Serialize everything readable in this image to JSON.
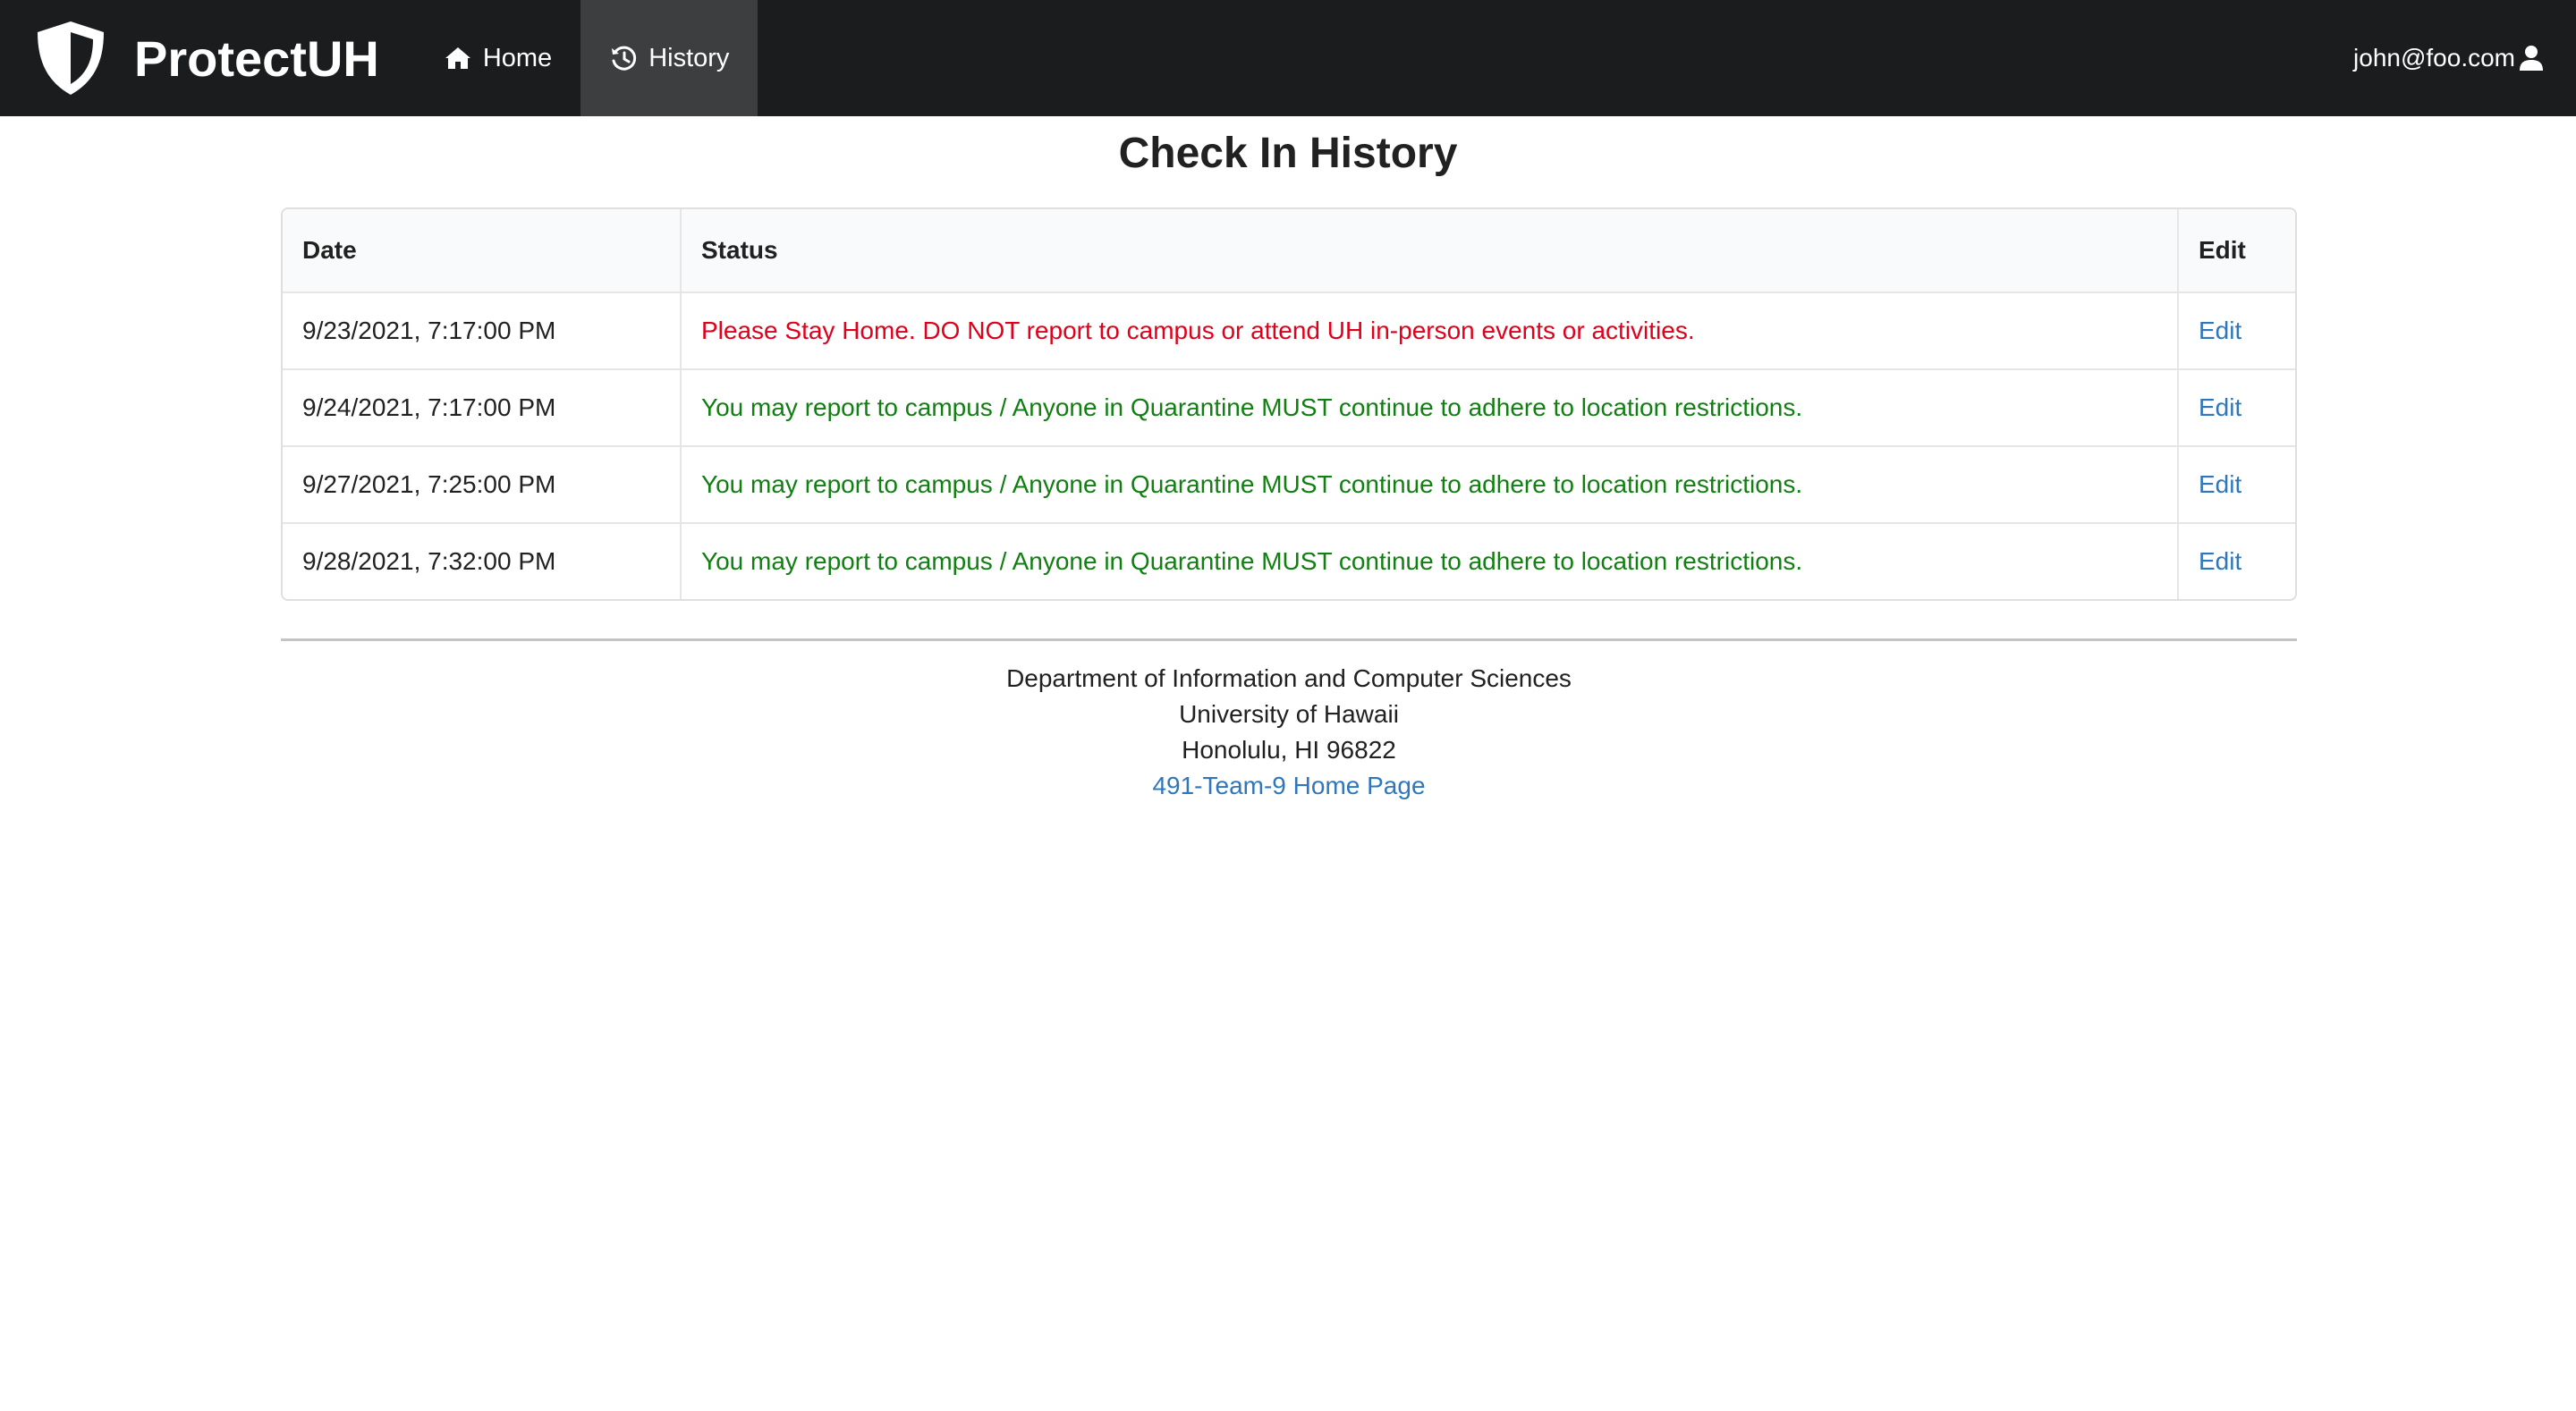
{
  "nav": {
    "brand": "ProtectUH",
    "items": [
      {
        "label": "Home",
        "icon": "home-icon"
      },
      {
        "label": "History",
        "icon": "history-icon",
        "active": true
      }
    ],
    "user_email": "john@foo.com",
    "user_icon": "user-icon"
  },
  "page": {
    "title": "Check In History"
  },
  "table": {
    "headers": {
      "date": "Date",
      "status": "Status",
      "edit": "Edit"
    },
    "rows": [
      {
        "date": "9/23/2021, 7:17:00 PM",
        "status": "Please Stay Home. DO NOT report to campus or attend UH in-person events or activities.",
        "status_type": "stay-home",
        "edit": "Edit"
      },
      {
        "date": "9/24/2021, 7:17:00 PM",
        "status": "You may report to campus / Anyone in Quarantine MUST continue to adhere to location restrictions.",
        "status_type": "clear",
        "edit": "Edit"
      },
      {
        "date": "9/27/2021, 7:25:00 PM",
        "status": "You may report to campus / Anyone in Quarantine MUST continue to adhere to location restrictions.",
        "status_type": "clear",
        "edit": "Edit"
      },
      {
        "date": "9/28/2021, 7:32:00 PM",
        "status": "You may report to campus / Anyone in Quarantine MUST continue to adhere to location restrictions.",
        "status_type": "clear",
        "edit": "Edit"
      }
    ]
  },
  "footer": {
    "line1": "Department of Information and Computer Sciences",
    "line2": "University of Hawaii",
    "line3": "Honolulu, HI 96822",
    "link": "491-Team-9 Home Page"
  },
  "colors": {
    "navbar": "#1b1c1d",
    "nav_active": "#3d3e3f",
    "status_red": "#e0001b",
    "status_green": "#117f11",
    "link": "#2f76bb"
  }
}
